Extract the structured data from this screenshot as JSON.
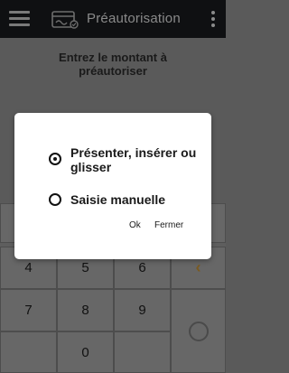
{
  "app_bar": {
    "title": "Préautorisation",
    "menu_icon": "hamburger-menu-icon",
    "card_icon": "card-icon",
    "more_icon": "more-vertical-icon"
  },
  "prompt": "Entrez le montant à préautoriser",
  "dialog": {
    "options": [
      {
        "label": "Présenter, insérer ou glisser",
        "selected": true
      },
      {
        "label": "Saisie manuelle",
        "selected": false
      }
    ],
    "ok_label": "Ok",
    "close_label": "Fermer"
  },
  "keypad": {
    "row2": [
      "4",
      "5",
      "6"
    ],
    "row3": [
      "7",
      "8",
      "9"
    ],
    "row4": [
      "0"
    ],
    "backspace_icon": "backspace-chevron-icon",
    "confirm_icon": "circle-icon"
  }
}
